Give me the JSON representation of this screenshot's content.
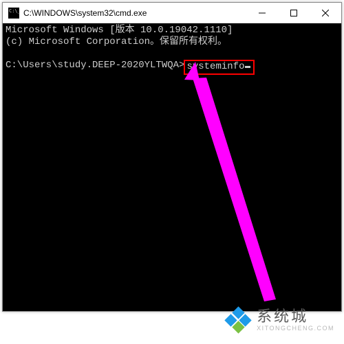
{
  "window": {
    "title": "C:\\WINDOWS\\system32\\cmd.exe"
  },
  "terminal": {
    "banner_line1": "Microsoft Windows [版本 10.0.19042.1110]",
    "banner_line2": "(c) Microsoft Corporation。保留所有权利。",
    "prompt": "C:\\Users\\study.DEEP-2020YLTWQA>",
    "command": "systeminfo"
  },
  "watermark": {
    "title": "系统城",
    "subtitle": "XITONGCHENG.COM"
  },
  "colors": {
    "highlight_border": "#ff0000",
    "arrow": "#ff00ff",
    "terminal_bg": "#000000",
    "terminal_fg": "#cccccc"
  }
}
